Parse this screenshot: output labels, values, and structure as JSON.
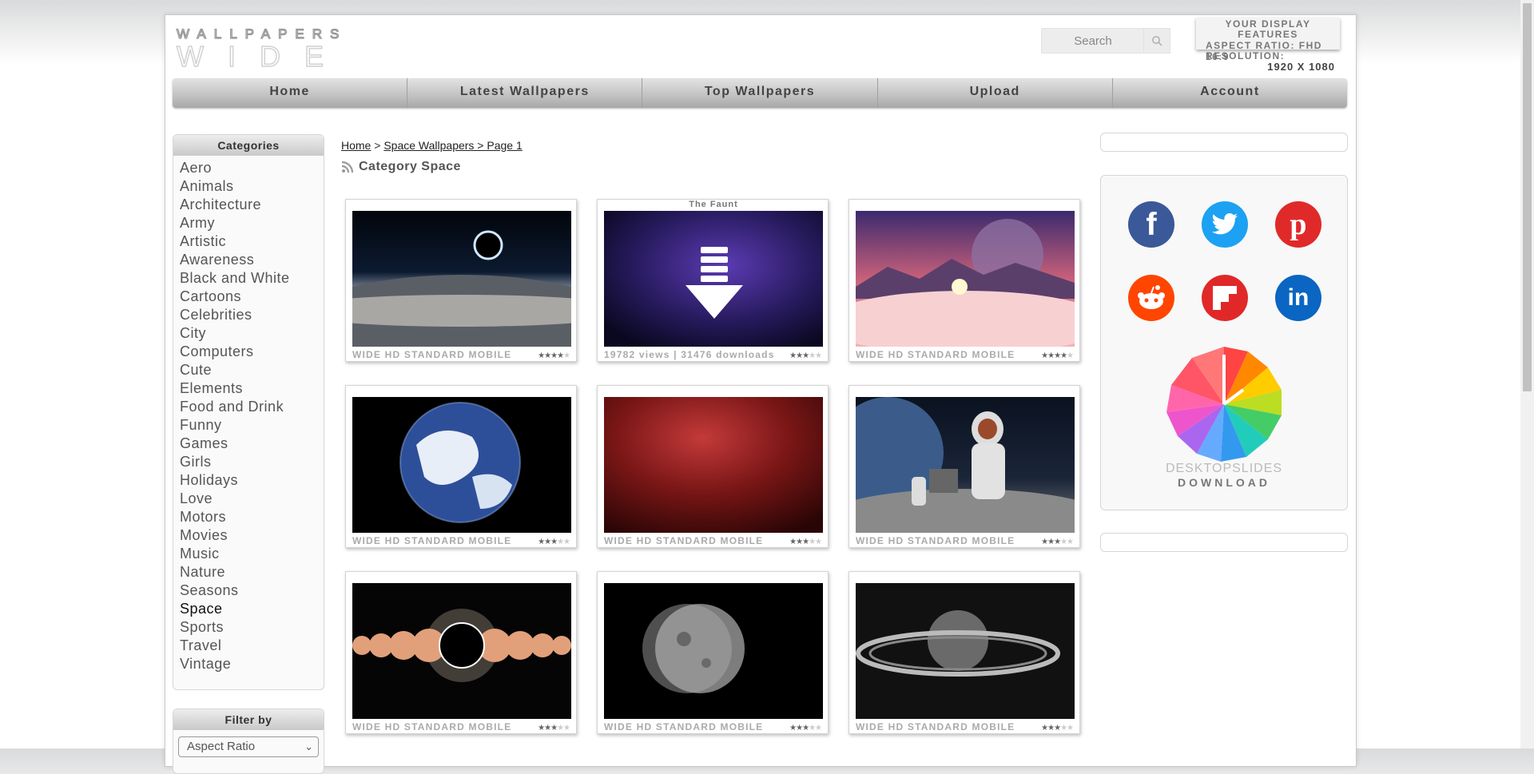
{
  "header": {
    "logo_line1": "WALLPAPERS",
    "logo_line2": "WIDE",
    "search_placeholder": "Search",
    "display": {
      "title": "YOUR DISPLAY FEATURES",
      "aspect": "ASPECT RATIO: FHD 16:9",
      "res_label": "RESOLUTION:",
      "res_value": "1920 X 1080"
    }
  },
  "nav": [
    "Home",
    "Latest Wallpapers",
    "Top Wallpapers",
    "Upload",
    "Account"
  ],
  "sidebar": {
    "categories_title": "Categories",
    "categories": [
      "Aero",
      "Animals",
      "Architecture",
      "Army",
      "Artistic",
      "Awareness",
      "Black and White",
      "Cartoons",
      "Celebrities",
      "City",
      "Computers",
      "Cute",
      "Elements",
      "Food and Drink",
      "Funny",
      "Games",
      "Girls",
      "Holidays",
      "Love",
      "Motors",
      "Movies",
      "Music",
      "Nature",
      "Seasons",
      "Space",
      "Sports",
      "Travel",
      "Vintage"
    ],
    "active_category": "Space",
    "filter_title": "Filter by",
    "filter_value": "Aspect Ratio"
  },
  "breadcrumb": {
    "home": "Home",
    "sep": ">",
    "current": "Space Wallpapers > Page 1"
  },
  "category_title": "Category Space",
  "thumbs": [
    {
      "caption": "",
      "footer": "WIDE HD STANDARD MOBILE",
      "stars": 4,
      "scene": "eclipse-earth"
    },
    {
      "caption": "The Faunt",
      "footer": "19782 views | 31476 downloads",
      "stars": 3,
      "scene": "nebula-download"
    },
    {
      "caption": "",
      "footer": "WIDE HD STANDARD MOBILE",
      "stars": 3.5,
      "scene": "planet-clouds"
    },
    {
      "caption": "",
      "footer": "WIDE HD STANDARD MOBILE",
      "stars": 3,
      "scene": "earth"
    },
    {
      "caption": "",
      "footer": "WIDE HD STANDARD MOBILE",
      "stars": 2.5,
      "scene": "red-nebula"
    },
    {
      "caption": "",
      "footer": "WIDE HD STANDARD MOBILE",
      "stars": 3,
      "scene": "astronaut"
    },
    {
      "caption": "",
      "footer": "WIDE HD STANDARD MOBILE",
      "stars": 2.5,
      "scene": "solar-eclipse"
    },
    {
      "caption": "",
      "footer": "WIDE HD STANDARD MOBILE",
      "stars": 2.5,
      "scene": "moon"
    },
    {
      "caption": "",
      "footer": "WIDE HD STANDARD MOBILE",
      "stars": 3,
      "scene": "saturn"
    }
  ],
  "social": [
    {
      "name": "facebook",
      "color": "#3b5998",
      "glyph": "f"
    },
    {
      "name": "twitter",
      "color": "#1da1f2",
      "glyph": "t"
    },
    {
      "name": "pinterest",
      "color": "#e02a2a",
      "glyph": "p"
    },
    {
      "name": "reddit",
      "color": "#ff4500",
      "glyph": "r"
    },
    {
      "name": "flipboard",
      "color": "#e12828",
      "glyph": "F"
    },
    {
      "name": "linkedin",
      "color": "#0a66c2",
      "glyph": "in"
    }
  ],
  "promo": {
    "line1": "DESKTOPSLIDES",
    "line2": "DOWNLOAD"
  }
}
